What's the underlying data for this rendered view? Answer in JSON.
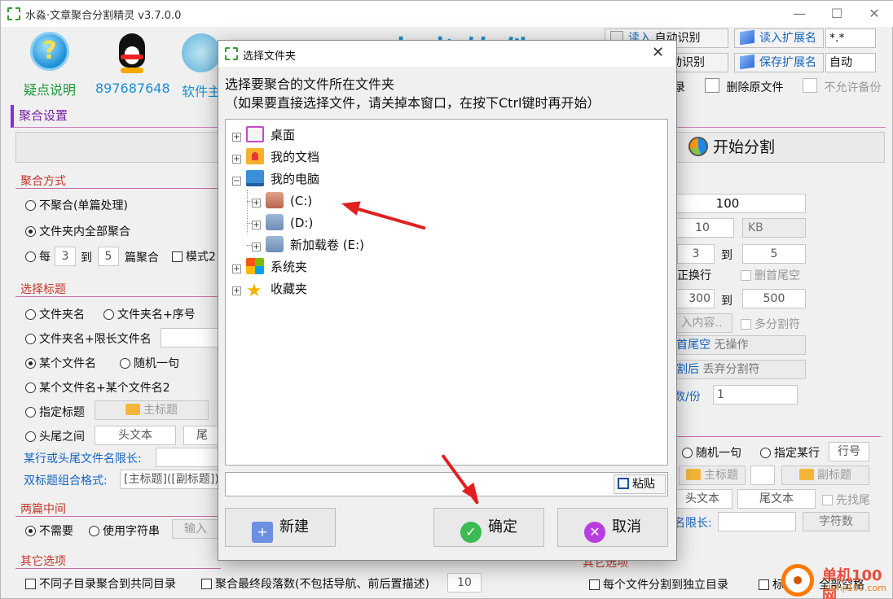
{
  "window": {
    "title": "水淼·文章聚合分割精灵 v3.7.0.0",
    "controls": [
      "—",
      "☐",
      "✕"
    ]
  },
  "toolbar": {
    "help_label": "疑点说明",
    "qq_label": "897687648",
    "software_label": "软件主",
    "brand": "水淼软件"
  },
  "top_right": {
    "read_label": "读入",
    "read_value": "自动识别",
    "save_value": "自动识别",
    "read_ext_label": "读入扩展名",
    "read_ext_value": "*.*",
    "save_ext_label": "保存扩展名",
    "save_ext_value": "自动",
    "record_suffix": "录",
    "delete_original": "删除原文件",
    "no_backup": "不允许备份"
  },
  "merge": {
    "title": "聚合设置",
    "start_split": "开始分割",
    "method_title": "聚合方式",
    "opt_no_merge": "不聚合(单篇处理)",
    "opt_all_in_folder": "文件夹内全部聚合",
    "opt_each_prefix": "每",
    "each_from": "3",
    "each_to_label": "到",
    "each_to": "5",
    "each_suffix": "篇聚合",
    "mode2": "模式2",
    "choose_title": "选择标题",
    "t_folder": "文件夹名",
    "t_folder_seq": "文件夹名+序号",
    "t_folder_len": "文件夹名+限长文件名",
    "t_some_file": "某个文件名",
    "t_random": "随机一句",
    "t_some_file2": "某个文件名+某个文件名2",
    "t_specified": "指定标题",
    "main_title_btn": "主标题",
    "t_head_tail": "头尾之间",
    "head_text": "头文本",
    "tail_text_short": "尾",
    "limit_label": "某行或头尾文件名限长:",
    "combo_label": "双标题组合格式:",
    "combo_value": "[主标题]([副标题])",
    "between_title": "两篇中间",
    "b_none": "不需要",
    "b_use_string": "使用字符串",
    "b_input": "输入",
    "other_title": "其它选项",
    "other_diff_dir": "不同子目录聚合到共同目录",
    "other_final_para": "聚合最终段落数(不包括导航、前后置描述)",
    "other_final_value": "10"
  },
  "split": {
    "v100": "100",
    "v10": "10",
    "unit": "KB",
    "from1": "3",
    "to_label": "到",
    "to1": "5",
    "correct_newline": "正换行",
    "del_head_tail_space": "删首尾空",
    "from2": "300",
    "to2": "500",
    "insert_content": "入内容..",
    "multi_sep": "多分割符",
    "trim_label": "首尾空",
    "trim_value": "无操作",
    "after_label": "割后",
    "after_value": "丢弃分割符",
    "count_label": "数/份",
    "count_value": "1",
    "r_random": "随机一句",
    "r_specified_line": "指定某行",
    "line_no": "行号",
    "main_title": "主标题",
    "sub_title": "副标题",
    "head_text": "头文本",
    "tail_text": "尾文本",
    "find_tail_first": "先找尾",
    "name_limit": "名限长:",
    "char_count": "字符数",
    "other_options": "其它选项",
    "each_file_dir": "每个文件分割到独立目录",
    "title_short": "标题",
    "all_spaces": "全部空格"
  },
  "dialog": {
    "title": "选择文件夹",
    "close": "✕",
    "prompt1": "选择要聚合的文件所在文件夹",
    "prompt2": "（如果要直接选择文件，请关掉本窗口，在按下Ctrl键时再开始）",
    "tree": {
      "desktop": "桌面",
      "my_docs": "我的文档",
      "my_computer": "我的电脑",
      "drive_c": "(C:)",
      "drive_d": "(D:)",
      "drive_e": "新加载卷 (E:)",
      "system": "系统夹",
      "favorites": "收藏夹"
    },
    "path_value": "",
    "paste": "粘贴",
    "new_btn": "新建",
    "ok_btn": "确定",
    "cancel_btn": "取消"
  },
  "watermark": {
    "line1": "单机100网",
    "line2": "danji100.com"
  }
}
